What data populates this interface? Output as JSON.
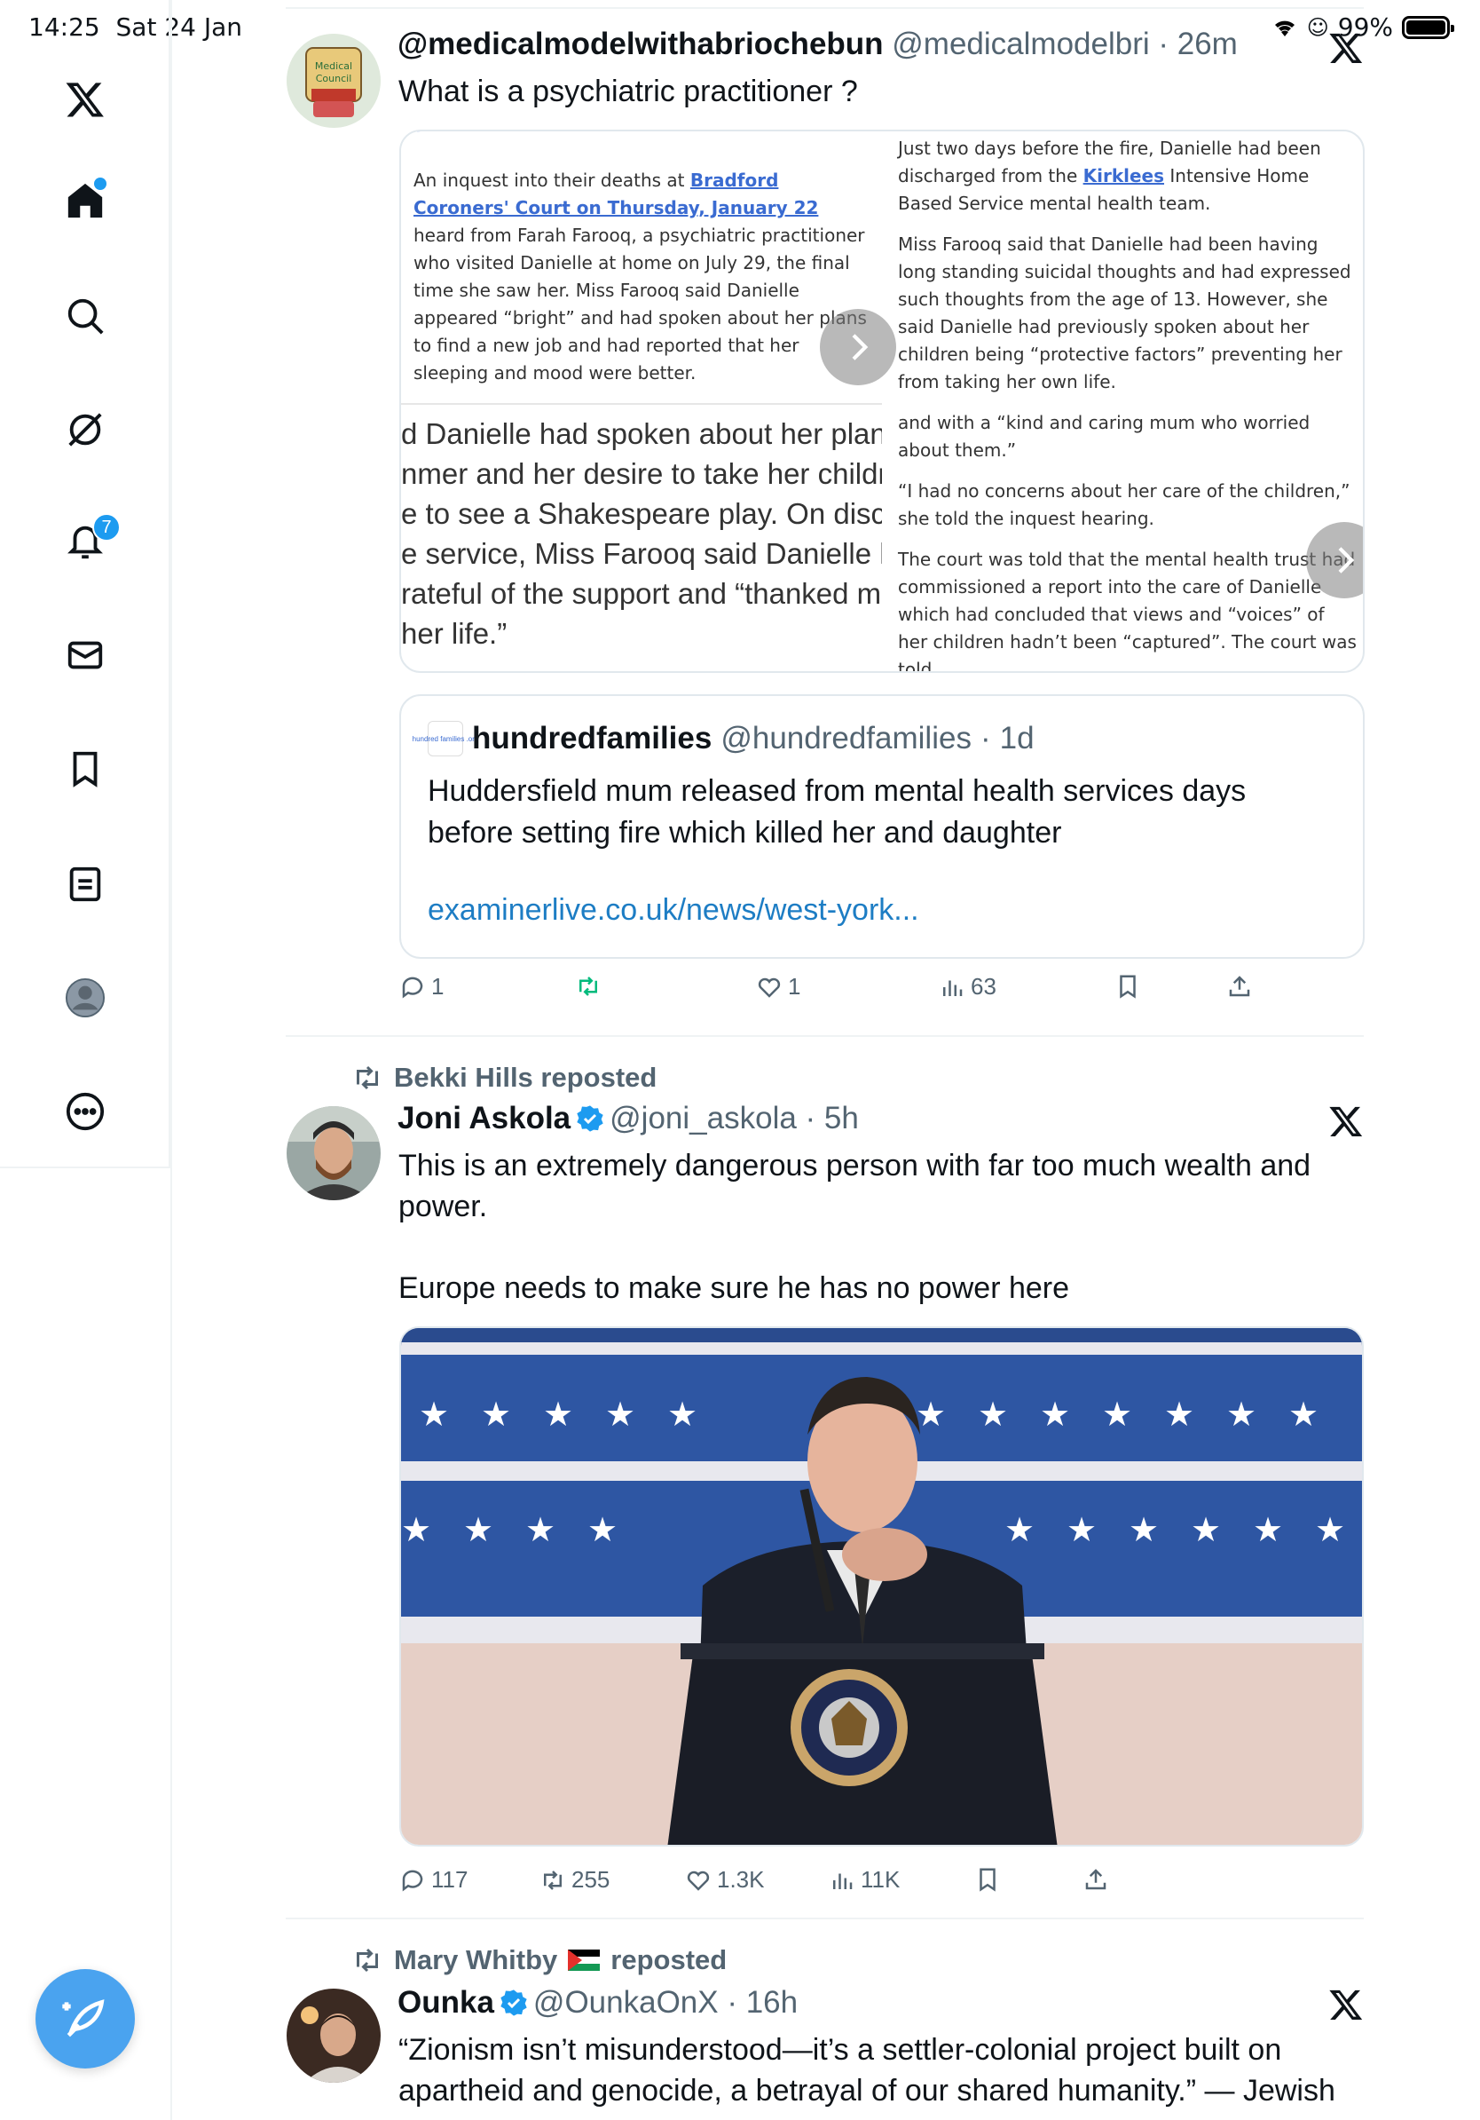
{
  "status": {
    "time": "14:25",
    "date": "Sat 24 Jan",
    "battery": "99%"
  },
  "sidebar": {
    "notification_count": "7"
  },
  "tweets": [
    {
      "display_name": "@medicalmodelwithabriochebun",
      "handle": "@medicalmodelbri",
      "age": "26m",
      "text": "What is a psychiatric practitioner ?",
      "media": {
        "left_top_parts": [
          "An inquest into their deaths at ",
          "Bradford Coroners' Court on Thursday, January 22",
          " heard from Farah Farooq, a psychiatric practitioner who visited Danielle at home on July 29, the final time she saw her. Miss Farooq said Danielle appeared “bright” and had spoken about her plans to find a new job and had reported that her sleeping and mood were better."
        ],
        "left_bottom_lines": [
          "d Danielle had spoken about her plans",
          "nmer and her desire to take her childre",
          "e to see a Shakespeare play. On dischar",
          "e service, Miss Farooq said Danielle ha",
          "rateful of the support and “thanked me",
          "her life.”"
        ],
        "right_p1_parts": [
          "Just two days before the fire, Danielle had been discharged from the ",
          "Kirklees",
          " Intensive Home Based Service mental health team."
        ],
        "right_p2": "Miss Farooq said that Danielle had been having long standing suicidal thoughts and had expressed such thoughts from the age of 13. However, she said Danielle had previously spoken about her children being “protective factors” preventing her from taking her own life.",
        "right_p3": "and with a “kind and caring mum who worried about them.”",
        "right_p4": "“I had no concerns about her care of the children,” she told the inquest hearing.",
        "right_p5": "The court was told that the mental health trust had commissioned a report into the care of Danielle which had concluded that views and “voices” of her children hadn’t been “captured”. The court was told"
      },
      "quote": {
        "avatar_text": "hundred families .org",
        "display_name": "hundredfamilies",
        "handle": "@hundredfamilies",
        "age": "1d",
        "text": "Huddersfield mum released from mental health services days before setting fire which killed her and daughter",
        "link": "examinerlive.co.uk/news/west-york..."
      },
      "stats": {
        "replies": "1",
        "reposts": "",
        "likes": "1",
        "views": "63"
      }
    },
    {
      "reposted_by": "Bekki Hills reposted",
      "display_name": "Joni Askola",
      "handle": "@joni_askola",
      "age": "5h",
      "text_line1": "This is an extremely dangerous person with far too much wealth and power.",
      "text_line2": "Europe needs to make sure he has no power here",
      "stats": {
        "replies": "117",
        "reposts": "255",
        "likes": "1.3K",
        "views": "11K"
      }
    },
    {
      "reposted_by": "Mary Whitby",
      "reposted_suffix": "reposted",
      "display_name": "Ounka",
      "handle": "@OunkaOnX",
      "age": "16h",
      "text": "“Zionism isn’t misunderstood—it’s a settler-colonial project built on apartheid and genocide, a betrayal of our shared humanity.” — Jewish"
    }
  ],
  "colors": {
    "accent": "#1d9bf0",
    "repost_green": "#00ba7c",
    "muted": "#536471"
  }
}
